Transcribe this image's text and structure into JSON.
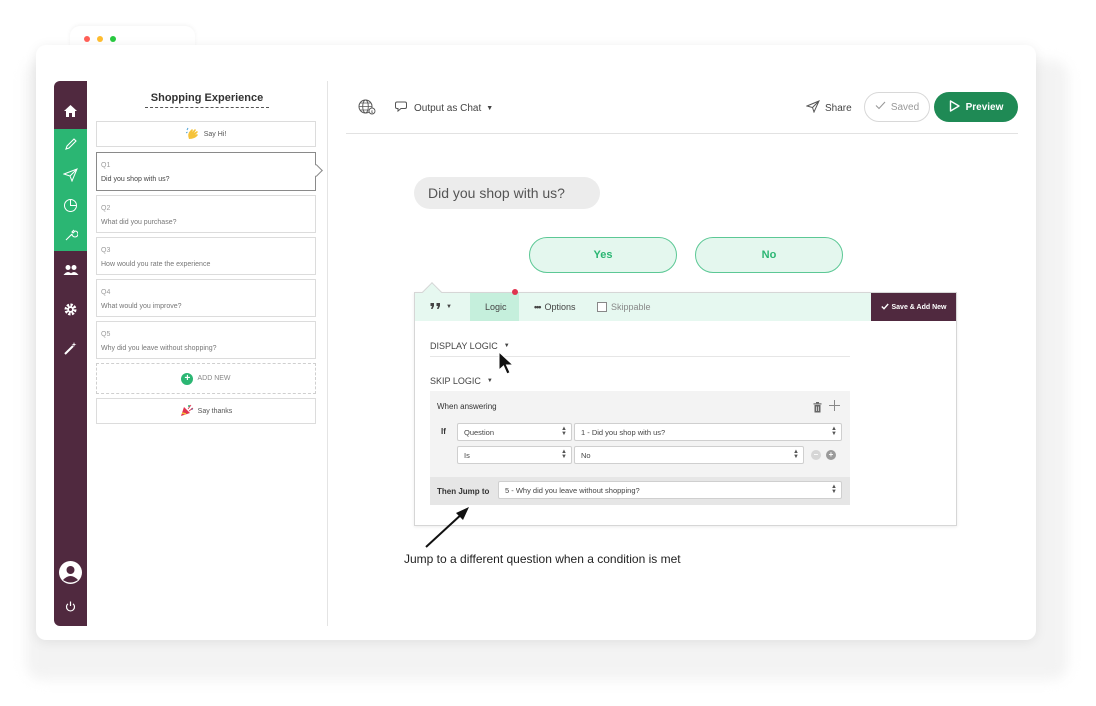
{
  "window": {
    "dot_colors": [
      "#ff5f57",
      "#febc2e",
      "#28c840"
    ]
  },
  "nav": {
    "items": [
      {
        "icon": "home-icon"
      },
      {
        "icon": "pencil-icon"
      },
      {
        "icon": "send-icon"
      },
      {
        "icon": "pie-chart-icon"
      },
      {
        "icon": "wrench-icon"
      },
      {
        "icon": "users-icon"
      },
      {
        "icon": "gear-icon"
      },
      {
        "icon": "magic-wand-icon"
      },
      {
        "icon": "avatar-icon"
      },
      {
        "icon": "power-icon"
      }
    ],
    "accent_color": "#2bb673",
    "rail_color": "#50293f"
  },
  "panel": {
    "title": "Shopping Experience",
    "welcome": "Say Hi!",
    "questions": [
      {
        "num": "Q1",
        "text": "Did you shop with us?"
      },
      {
        "num": "Q2",
        "text": "What did you purchase?"
      },
      {
        "num": "Q3",
        "text": "How would you rate the experience"
      },
      {
        "num": "Q4",
        "text": "What would you improve?"
      },
      {
        "num": "Q5",
        "text": "Why did you leave without shopping?"
      }
    ],
    "add_new": "ADD NEW",
    "thanks": "Say thanks"
  },
  "toolbar": {
    "output": "Output as Chat",
    "share": "Share",
    "saved": "Saved",
    "preview": "Preview"
  },
  "chat": {
    "question": "Did you shop with us?",
    "answers": [
      "Yes",
      "No"
    ]
  },
  "logic": {
    "tab_logic": "Logic",
    "tab_options": "Options",
    "skippable": "Skippable",
    "save_add": "Save & Add New",
    "display_logic": "DISPLAY LOGIC",
    "skip_logic": "SKIP LOGIC",
    "when_answering": "When answering",
    "if_label": "If",
    "field_question": "Question",
    "field_question_value": "1 - Did you shop with us?",
    "operator": "Is",
    "operator_value": "No",
    "then_jump": "Then Jump to",
    "jump_target": "5 - Why did you leave without shopping?"
  },
  "annotation": "Jump to a different question when a condition is met"
}
